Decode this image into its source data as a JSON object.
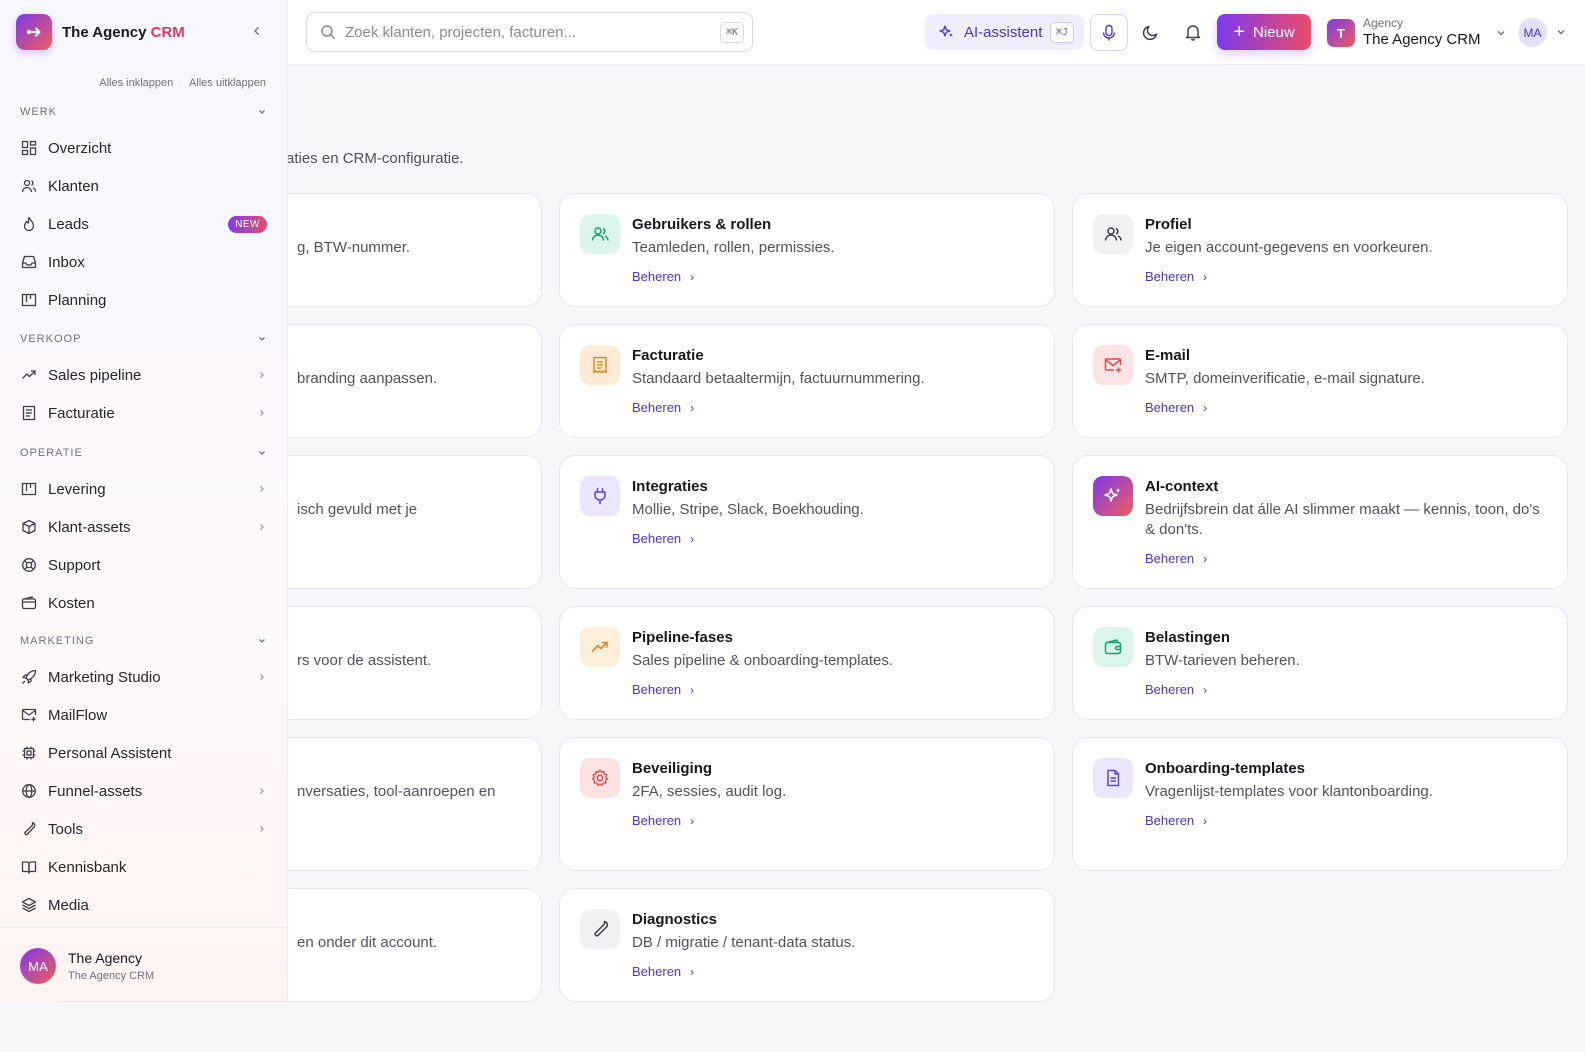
{
  "header": {
    "search_placeholder": "Zoek klanten, projecten, facturen...",
    "search_shortcut": "⌘K",
    "ai_label": "AI-assistent",
    "ai_shortcut": "⌘J",
    "new_label": "Nieuw",
    "tenant_initial": "T",
    "tenant_type": "Agency",
    "tenant_name": "The Agency CRM",
    "user_initials": "MA"
  },
  "sidebar": {
    "brand_main": "The Agency ",
    "brand_accent": "CRM",
    "collapse_all": "Alles inklappen",
    "expand_all": "Alles uitklappen",
    "sections": {
      "werk": "WERK",
      "verkoop": "VERKOOP",
      "operatie": "OPERATIE",
      "marketing": "MARKETING"
    },
    "items": {
      "overzicht": "Overzicht",
      "klanten": "Klanten",
      "leads": "Leads",
      "leads_badge": "NEW",
      "inbox": "Inbox",
      "planning": "Planning",
      "sales_pipeline": "Sales pipeline",
      "facturatie": "Facturatie",
      "levering": "Levering",
      "klant_assets": "Klant-assets",
      "support": "Support",
      "kosten": "Kosten",
      "marketing_studio": "Marketing Studio",
      "mailflow": "MailFlow",
      "personal_assistent": "Personal Assistent",
      "funnel_assets": "Funnel-assets",
      "tools": "Tools",
      "kennisbank": "Kennisbank",
      "media": "Media"
    },
    "footer": {
      "initials": "MA",
      "name": "The Agency",
      "sub": "The Agency CRM"
    }
  },
  "main": {
    "subtitle_visible": "aties en CRM-configuratie.",
    "link_label": "Beheren",
    "partial_cards": [
      "g, BTW-nummer.",
      "branding aanpassen.",
      "isch gevuld met je",
      "rs voor de assistent.",
      "nversaties, tool-aanroepen en",
      "en onder dit account."
    ],
    "cards": {
      "gebruikers": {
        "title": "Gebruikers & rollen",
        "desc": "Teamleden, rollen, permissies."
      },
      "profiel": {
        "title": "Profiel",
        "desc": "Je eigen account-gegevens en voorkeuren."
      },
      "facturatie": {
        "title": "Facturatie",
        "desc": "Standaard betaaltermijn, factuurnummering."
      },
      "email": {
        "title": "E-mail",
        "desc": "SMTP, domeinverificatie, e-mail signature."
      },
      "integraties": {
        "title": "Integraties",
        "desc": "Mollie, Stripe, Slack, Boekhouding."
      },
      "ai_context": {
        "title": "AI-context",
        "desc": "Bedrijfsbrein dat álle AI slimmer maakt — kennis, toon, do's & don'ts."
      },
      "pipeline": {
        "title": "Pipeline-fases",
        "desc": "Sales pipeline & onboarding-templates."
      },
      "belastingen": {
        "title": "Belastingen",
        "desc": "BTW-tarieven beheren."
      },
      "beveiliging": {
        "title": "Beveiliging",
        "desc": "2FA, sessies, audit log."
      },
      "onboarding": {
        "title": "Onboarding-templates",
        "desc": "Vragenlijst-templates voor klantonboarding."
      },
      "diagnostics": {
        "title": "Diagnostics",
        "desc": "DB / migratie / tenant-data status."
      }
    }
  }
}
